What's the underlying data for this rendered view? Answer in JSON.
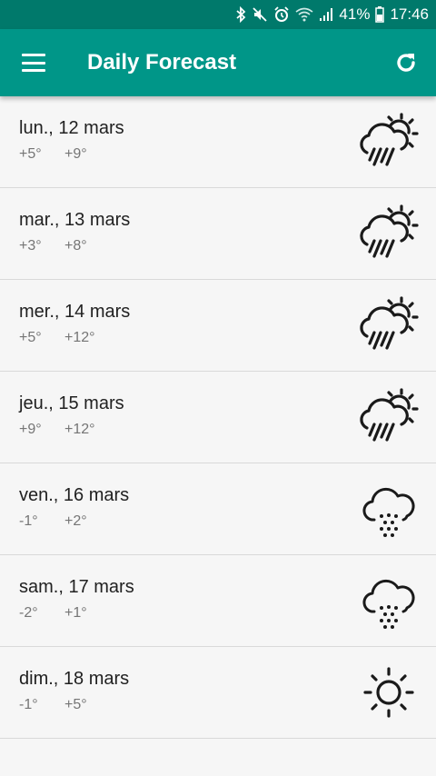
{
  "status_bar": {
    "battery": "41%",
    "time": "17:46",
    "icons": [
      "bluetooth-icon",
      "mute-icon",
      "alarm-icon",
      "wifi-icon",
      "signal-icon",
      "battery-icon"
    ]
  },
  "toolbar": {
    "title": "Daily Forecast",
    "menu_icon": "hamburger-menu-icon",
    "refresh_icon": "refresh-icon"
  },
  "colors": {
    "status_bar": "#00796b",
    "toolbar": "#009688",
    "background": "#f6f6f6",
    "secondary_text": "#757575"
  },
  "forecast": [
    {
      "date": "lun., 12 mars",
      "min": "+5°",
      "max": "+9°",
      "icon": "rain-sun-cloud-icon"
    },
    {
      "date": "mar., 13 mars",
      "min": "+3°",
      "max": "+8°",
      "icon": "rain-sun-cloud-icon"
    },
    {
      "date": "mer., 14 mars",
      "min": "+5°",
      "max": "+12°",
      "icon": "rain-sun-cloud-icon"
    },
    {
      "date": "jeu., 15 mars",
      "min": "+9°",
      "max": "+12°",
      "icon": "rain-sun-cloud-icon"
    },
    {
      "date": "ven., 16 mars",
      "min": "-1°",
      "max": "+2°",
      "icon": "snow-cloud-icon"
    },
    {
      "date": "sam., 17 mars",
      "min": "-2°",
      "max": "+1°",
      "icon": "snow-cloud-icon"
    },
    {
      "date": "dim., 18 mars",
      "min": "-1°",
      "max": "+5°",
      "icon": "sun-icon"
    }
  ]
}
